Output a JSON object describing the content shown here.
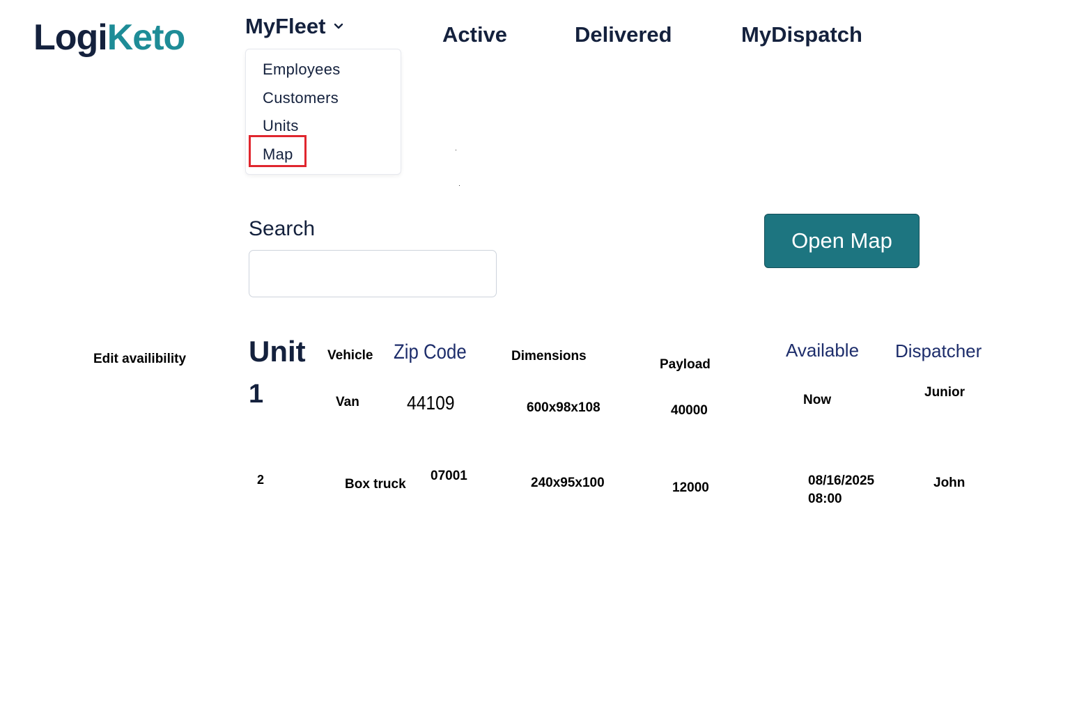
{
  "logo": {
    "part1": "Logi",
    "part2": "Keto"
  },
  "nav": {
    "fleet": "MyFleet",
    "active": "Active",
    "delivered": "Delivered",
    "dispatch": "MyDispatch"
  },
  "dropdown": {
    "items": [
      "Employees",
      "Customers",
      "Units",
      "Map"
    ],
    "highlighted": "Map",
    "highlight_color": "#e0262e"
  },
  "search": {
    "label": "Search",
    "value": "",
    "placeholder": ""
  },
  "open_map": {
    "label": "Open Map",
    "color": "#1d7580"
  },
  "edit_availability": "Edit availibility",
  "table": {
    "headers": {
      "unit": "Unit",
      "vehicle": "Vehicle",
      "zip": "Zip Code",
      "dimensions": "Dimensions",
      "payload": "Payload",
      "available": "Available",
      "dispatcher": "Dispatcher"
    },
    "rows": [
      {
        "unit": "1",
        "vehicle": "Van",
        "zip": "44109",
        "dimensions": "600x98x108",
        "payload": "40000",
        "available": "Now",
        "dispatcher": "Junior"
      },
      {
        "unit": "2",
        "vehicle": "Box truck",
        "zip": "07001",
        "dimensions": "240x95x100",
        "payload": "12000",
        "available_date": "08/16/2025",
        "available_time": "08:00",
        "dispatcher": "John"
      }
    ]
  },
  "colors": {
    "navy": "#14213d",
    "teal": "#1e8c97"
  }
}
